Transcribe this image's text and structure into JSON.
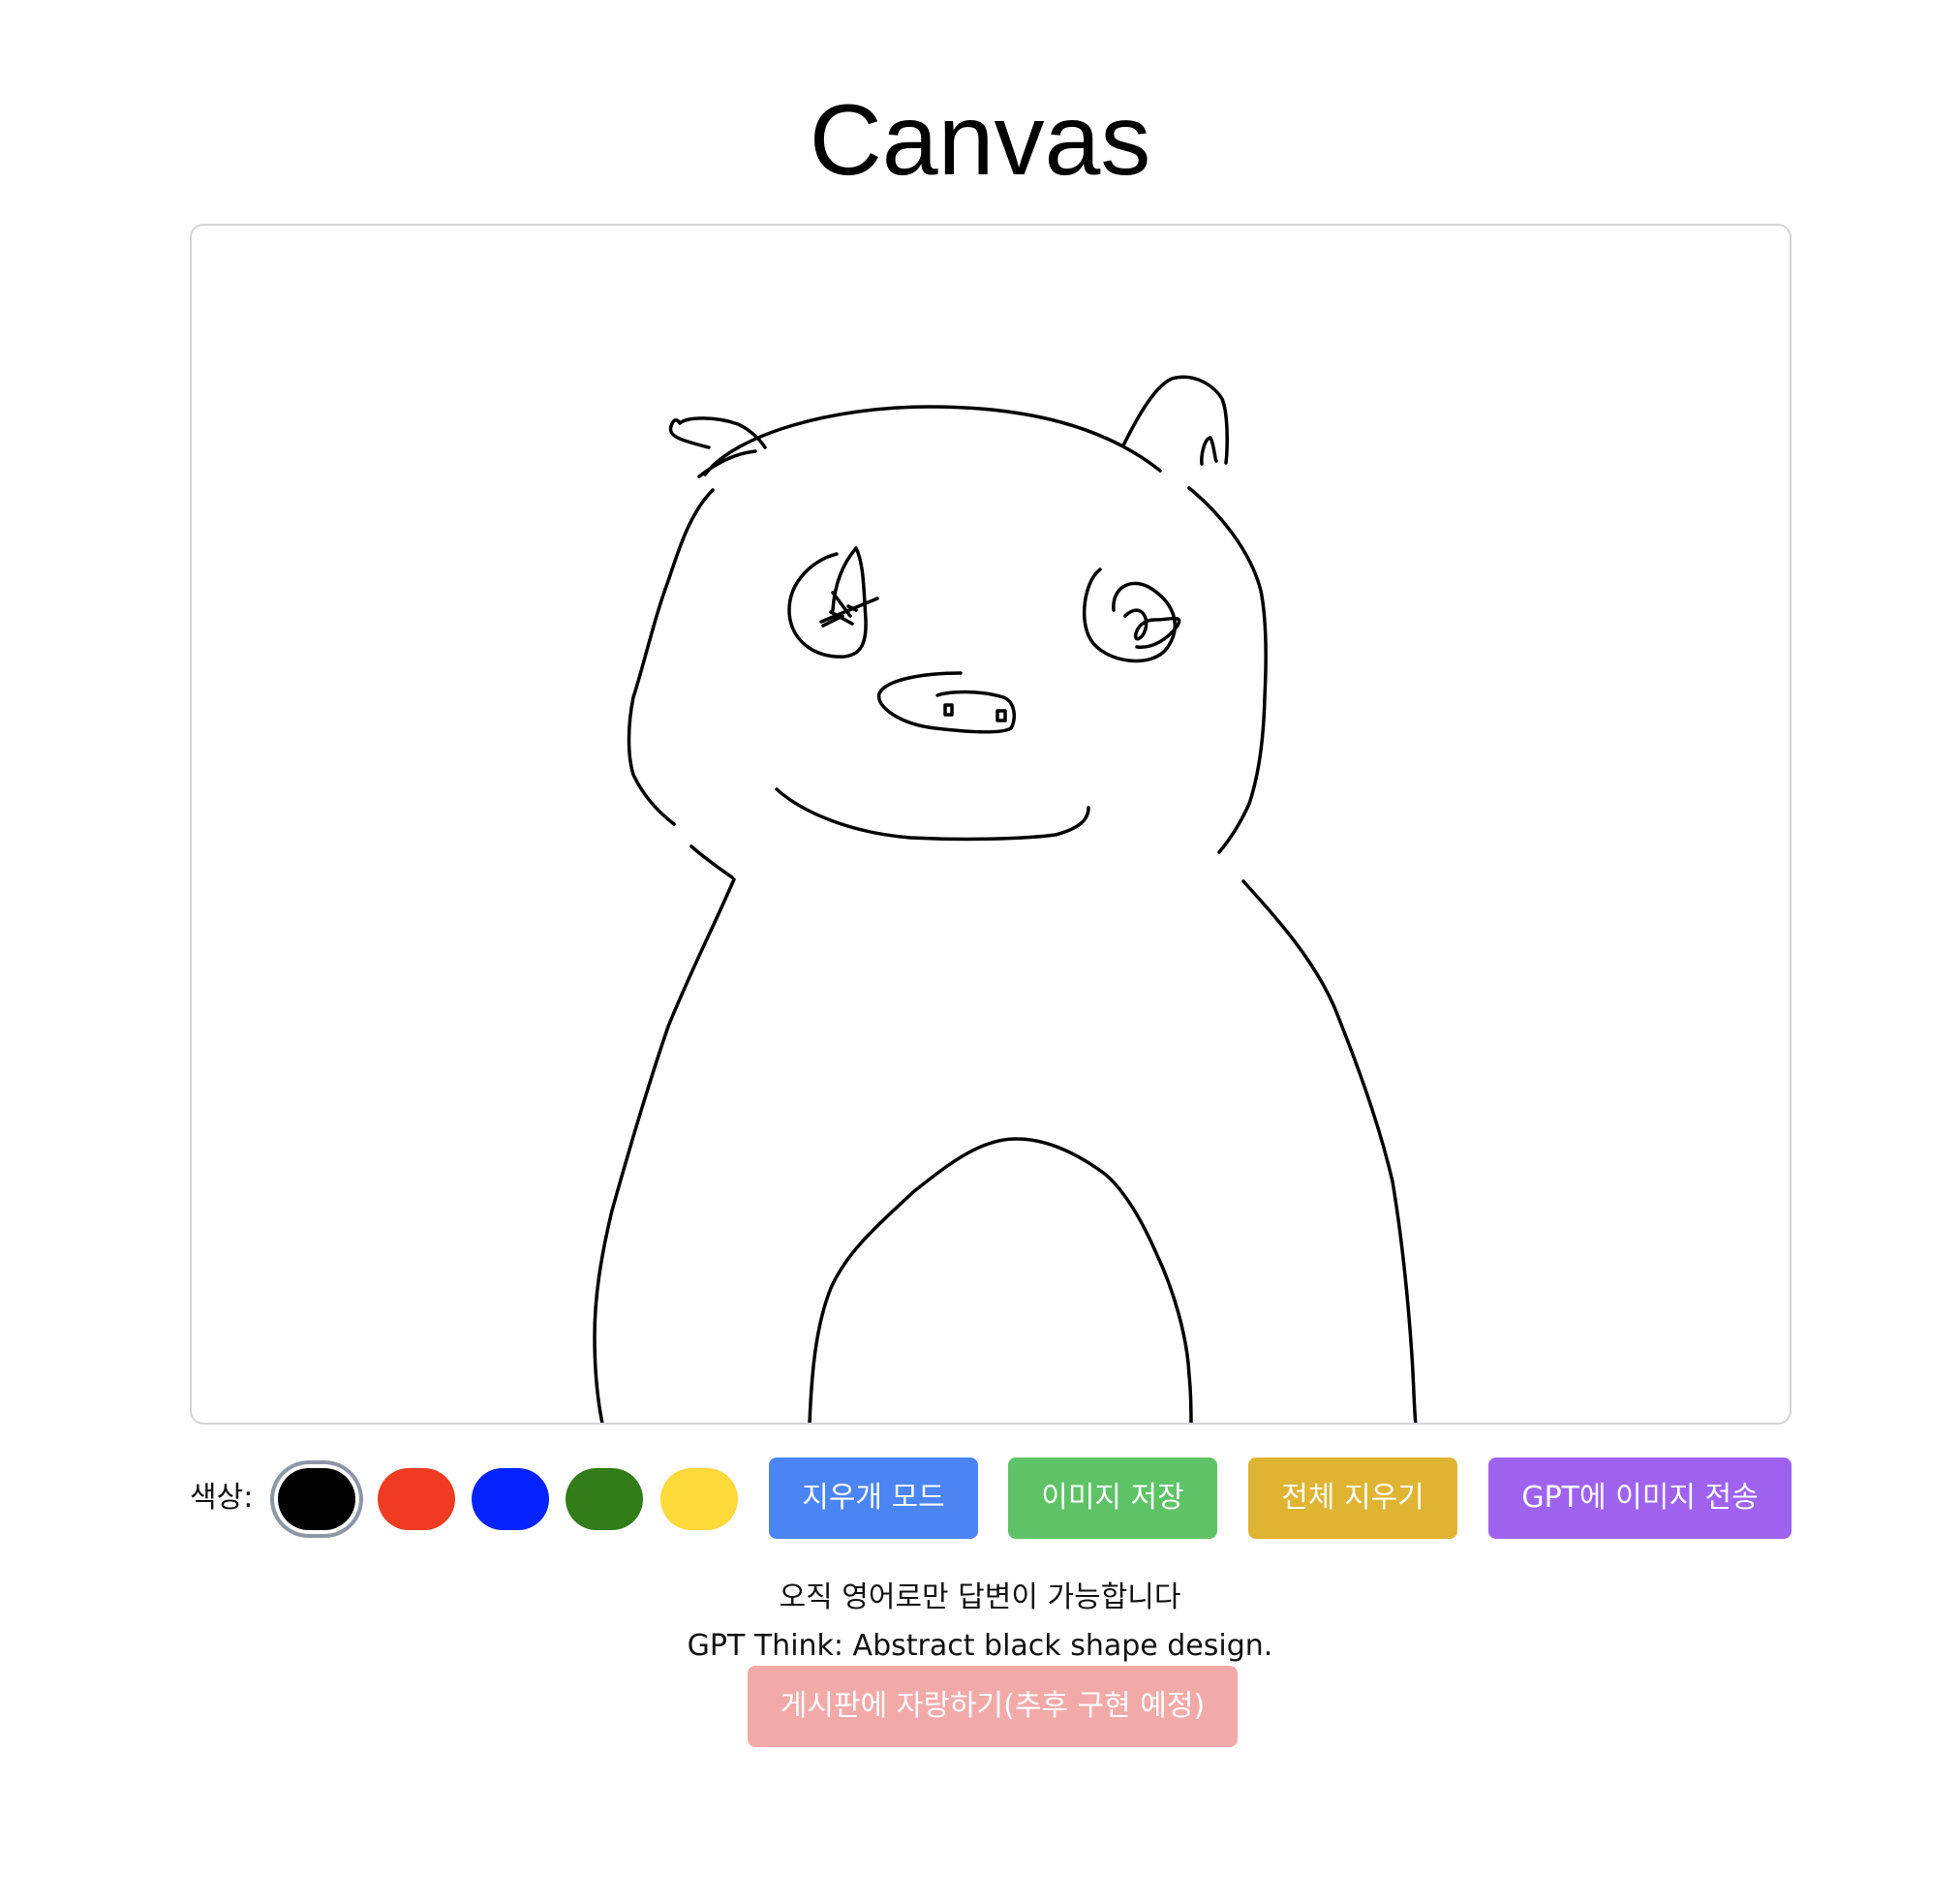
{
  "header": {
    "title": "Canvas"
  },
  "canvas": {
    "drawing": "bear-sketch"
  },
  "toolbar": {
    "color_label": "색상:",
    "colors": [
      {
        "name": "black",
        "hex": "#000000",
        "selected": true
      },
      {
        "name": "red",
        "hex": "#ee3b22",
        "selected": false
      },
      {
        "name": "blue",
        "hex": "#0423ff",
        "selected": false
      },
      {
        "name": "green",
        "hex": "#327d1a",
        "selected": false
      },
      {
        "name": "yellow",
        "hex": "#fdd93a",
        "selected": false
      }
    ],
    "eraser_label": "지우개 모드",
    "save_label": "이미지 저장",
    "clear_label": "전체 지우기",
    "send_label": "GPT에 이미지 전송"
  },
  "button_colors": {
    "eraser": "#4b85f3",
    "save": "#5ec366",
    "clear": "#e0b433",
    "send": "#9e62ef",
    "brag": "#f2aaa8"
  },
  "info": {
    "notice": "오직 영어로만 답변이 가능합니다",
    "gpt_result": "GPT Think: Abstract black shape design."
  },
  "share": {
    "brag_label": "게시판에 자랑하기(추후 구현 예정)"
  }
}
